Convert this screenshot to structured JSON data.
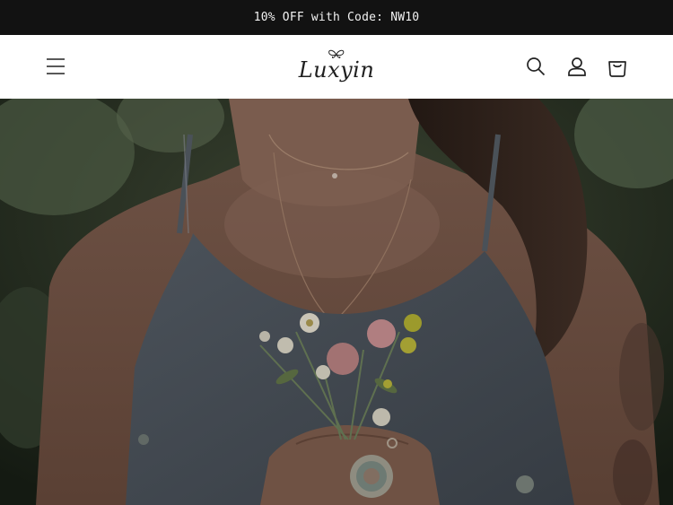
{
  "announcement": {
    "text": "10% OFF with Code: NW10"
  },
  "header": {
    "logo_text": "Luxyin",
    "icons": {
      "menu": "menu-icon",
      "search": "search-icon",
      "account": "account-icon",
      "cart": "cart-icon"
    }
  },
  "hero": {
    "image": "woman-holding-wildflowers-photo"
  },
  "colors": {
    "announcement_bg": "#121212",
    "header_bg": "#ffffff",
    "text": "#1f1f1f"
  }
}
